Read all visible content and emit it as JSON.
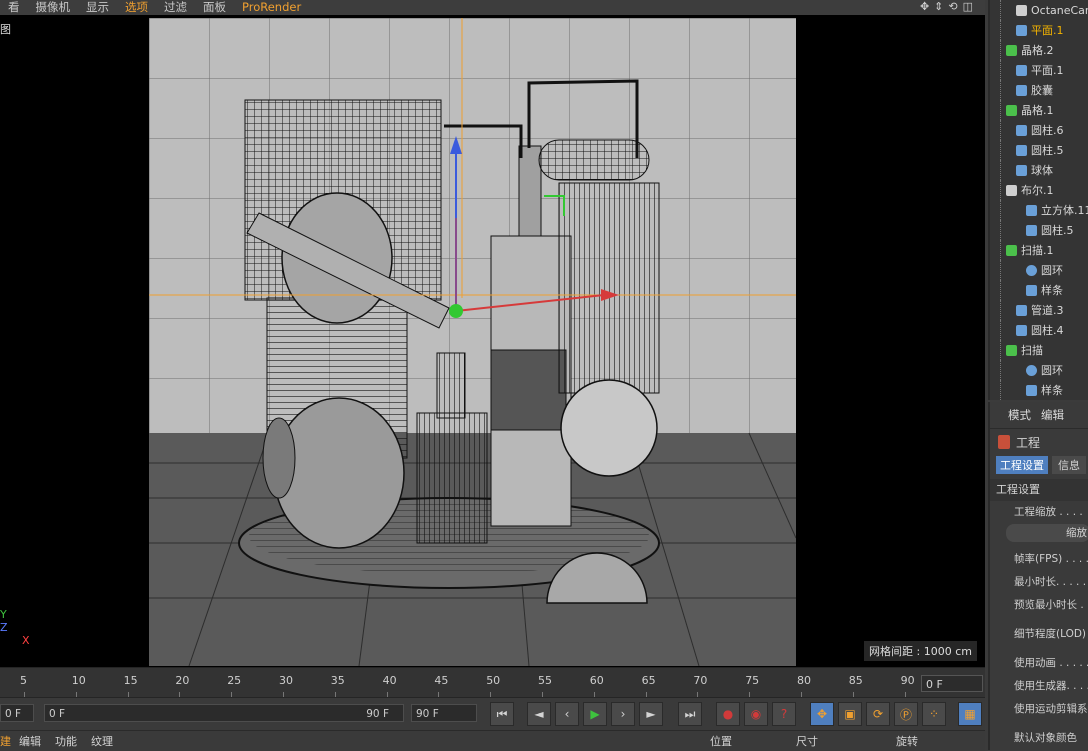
{
  "menu": {
    "items": [
      "看",
      "摄像机",
      "显示",
      "选项",
      "过滤",
      "面板",
      "ProRender"
    ],
    "active_index": 3,
    "nav_icons": [
      "move-view-icon",
      "zoom-icon",
      "rotate-view-icon",
      "toggle-view-icon"
    ]
  },
  "viewport": {
    "label": "图",
    "grid_spacing": "网格间距 : 1000 cm",
    "axis_y": "Y",
    "axis_z": "Z",
    "axis_x": "X"
  },
  "outliner": {
    "items": [
      {
        "label": "OctaneCam",
        "icon": "camera-icon",
        "indent": 1,
        "selected": false
      },
      {
        "label": "平面.1",
        "icon": "plane-icon",
        "indent": 1,
        "selected": true
      },
      {
        "label": "晶格.2",
        "icon": "lattice-icon",
        "indent": 0,
        "selected": false
      },
      {
        "label": "平面.1",
        "icon": "polygon-icon",
        "indent": 1,
        "selected": false
      },
      {
        "label": "胶囊",
        "icon": "polygon-icon",
        "indent": 1,
        "selected": false
      },
      {
        "label": "晶格.1",
        "icon": "lattice-icon",
        "indent": 0,
        "selected": false
      },
      {
        "label": "圆柱.6",
        "icon": "polygon-icon",
        "indent": 1,
        "selected": false
      },
      {
        "label": "圆柱.5",
        "icon": "cylinder-icon",
        "indent": 1,
        "selected": false
      },
      {
        "label": "球体",
        "icon": "polygon-icon",
        "indent": 1,
        "selected": false
      },
      {
        "label": "布尔.1",
        "icon": "boole-icon",
        "indent": 0,
        "selected": false
      },
      {
        "label": "立方体.11",
        "icon": "cube-icon",
        "indent": 2,
        "selected": false
      },
      {
        "label": "圆柱.5",
        "icon": "cylinder-icon",
        "indent": 2,
        "selected": false
      },
      {
        "label": "扫描.1",
        "icon": "sweep-icon",
        "indent": 0,
        "selected": false
      },
      {
        "label": "圆环",
        "icon": "circle-icon",
        "indent": 2,
        "selected": false
      },
      {
        "label": "样条",
        "icon": "spline-icon",
        "indent": 2,
        "selected": false
      },
      {
        "label": "管道.3",
        "icon": "cylinder-icon",
        "indent": 1,
        "selected": false
      },
      {
        "label": "圆柱.4",
        "icon": "cylinder-icon",
        "indent": 1,
        "selected": false
      },
      {
        "label": "扫描",
        "icon": "sweep-icon",
        "indent": 0,
        "selected": false
      },
      {
        "label": "圆环",
        "icon": "circle-icon",
        "indent": 2,
        "selected": false
      },
      {
        "label": "样条",
        "icon": "spline-icon",
        "indent": 2,
        "selected": false
      }
    ]
  },
  "attributes": {
    "tabs": [
      "模式",
      "编辑"
    ],
    "project_title": "工程",
    "subtabs": [
      "工程设置",
      "信息"
    ],
    "section": "工程设置",
    "rows": [
      "工程缩放 . . . .",
      "缩放",
      "帧率(FPS) . . . . .",
      "最小时长. . . . . .",
      "预览最小时长 . .",
      "细节程度(LOD)",
      "使用动画 . . . . .",
      "使用生成器. . . . .",
      "使用运动剪辑系统",
      "默认对象颜色"
    ]
  },
  "timeline": {
    "ticks": [
      "5",
      "10",
      "15",
      "20",
      "25",
      "30",
      "35",
      "40",
      "45",
      "50",
      "55",
      "60",
      "65",
      "70",
      "75",
      "80",
      "85",
      "90"
    ],
    "current_frame": "0 F"
  },
  "transport": {
    "start_field": "0 F",
    "range_start": "0 F",
    "range_end": "90 F",
    "end_field": "90 F"
  },
  "bottom": {
    "left_tabs": [
      "建",
      "编辑",
      "功能",
      "纹理"
    ],
    "coord_headers": [
      "位置",
      "尺寸",
      "旋转"
    ]
  },
  "colors": {
    "accent": "#f0a030",
    "selected": "#f4b400",
    "play": "#3ec23e",
    "record": "#d23a3a",
    "tool_active": "#4f7fbf"
  }
}
